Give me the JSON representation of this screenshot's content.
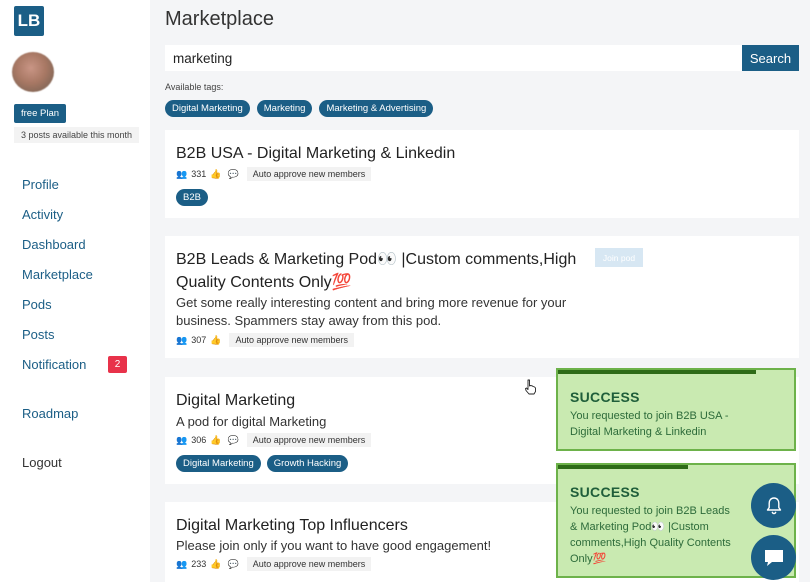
{
  "app": {
    "logo": "LB"
  },
  "sidebar": {
    "plan": "free Plan",
    "posts_available": "3 posts available this month",
    "nav": [
      "Profile",
      "Activity",
      "Dashboard",
      "Marketplace",
      "Pods",
      "Posts",
      "Notification"
    ],
    "notification_count": "2",
    "roadmap": "Roadmap",
    "logout": "Logout"
  },
  "main": {
    "title": "Marketplace",
    "search": {
      "value": "marketing",
      "button": "Search"
    },
    "tags_label": "Available tags:",
    "tags": [
      "Digital Marketing",
      "Marketing",
      "Marketing & Advertising"
    ],
    "pods": [
      {
        "title": "B2B USA - Digital Marketing & Linkedin",
        "description": "",
        "members": "331",
        "auto": "Auto approve new members",
        "tags": [
          "B2B"
        ]
      },
      {
        "title_line1": "B2B Leads & Marketing Pod👀 |Custom comments,High",
        "title_line2": "Quality Contents Only💯",
        "description_line1": "Get some really interesting content and bring more revenue for your",
        "description_line2": "business. Spammers stay away from this pod.",
        "members": "307",
        "auto": "Auto approve new members",
        "join": "Join pod"
      },
      {
        "title": "Digital Marketing",
        "description": "A pod for digital Marketing",
        "members": "306",
        "auto": "Auto approve new members",
        "tags": [
          "Digital Marketing",
          "Growth Hacking"
        ]
      },
      {
        "title": "Digital Marketing Top Influencers",
        "description": "Please join only if you want to have good engagement!",
        "members": "233",
        "auto": "Auto approve new members"
      }
    ]
  },
  "toasts": [
    {
      "title": "SUCCESS",
      "line1": "You requested to join B2B USA -",
      "line2": "Digital Marketing & Linkedin",
      "progress": 0.84
    },
    {
      "title": "SUCCESS",
      "line1": "You requested to join B2B Leads",
      "line2": "& Marketing Pod👀 |Custom",
      "line3": "comments,High Quality Contents",
      "line4": "Only💯",
      "progress": 0.55
    }
  ],
  "colors": {
    "primary": "#1b5e86",
    "badge": "#e8324a",
    "toast_bg": "#c9eab1",
    "toast_border": "#6db24a"
  },
  "icons": {
    "notification_fab": "bell-icon",
    "chat_fab": "chat-icon",
    "members": "group-icon",
    "likes": "thumbs-up-icon",
    "comments": "speech-bubble-icon"
  }
}
